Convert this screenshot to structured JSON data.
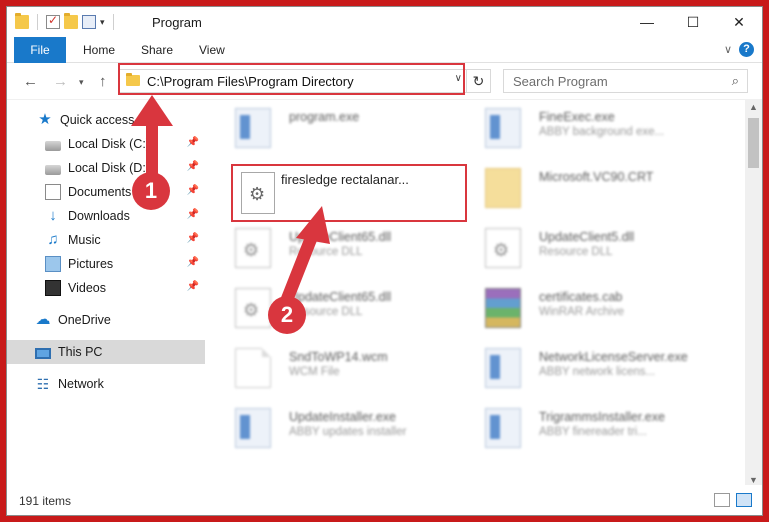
{
  "window": {
    "title": "Program",
    "controls": {
      "minimize": "—",
      "maximize": "☐",
      "close": "✕"
    }
  },
  "ribbon": {
    "tabs": [
      "File",
      "Home",
      "Share",
      "View"
    ],
    "expand_icon": "chevron-down-icon",
    "help": "?"
  },
  "nav": {
    "back": "←",
    "forward": "→",
    "recent": "▾",
    "up": "↑",
    "address": "C:\\Program Files\\Program Directory",
    "address_drop": "∨",
    "refresh": "↻",
    "search_placeholder": "Search Program",
    "search_icon": "⌕"
  },
  "sidebar": {
    "items": [
      {
        "label": "Quick access",
        "icon": "star-icon",
        "pinned": false
      },
      {
        "label": "Local Disk (C:)",
        "icon": "disk-icon",
        "pinned": true
      },
      {
        "label": "Local Disk (D:)",
        "icon": "disk-icon",
        "pinned": true
      },
      {
        "label": "Documents",
        "icon": "documents-icon",
        "pinned": true
      },
      {
        "label": "Downloads",
        "icon": "downloads-icon",
        "pinned": true
      },
      {
        "label": "Music",
        "icon": "music-icon",
        "pinned": true
      },
      {
        "label": "Pictures",
        "icon": "pictures-icon",
        "pinned": true
      },
      {
        "label": "Videos",
        "icon": "videos-icon",
        "pinned": true
      },
      {
        "label": "OneDrive",
        "icon": "onedrive-icon",
        "pinned": false
      },
      {
        "label": "This PC",
        "icon": "this-pc-icon",
        "pinned": false,
        "selected": true
      },
      {
        "label": "Network",
        "icon": "network-icon",
        "pinned": false
      }
    ]
  },
  "files": [
    {
      "name": "program.exe",
      "desc": "",
      "icon": "app-icon"
    },
    {
      "name": "FineExec.exe",
      "desc": "ABBY background exe...",
      "icon": "app-icon"
    },
    {
      "name": "firesledge rectalanar...",
      "desc": "",
      "icon": "gear-file-icon",
      "highlighted": true
    },
    {
      "name": "Microsoft.VC90.CRT",
      "desc": "",
      "icon": "folder-icon"
    },
    {
      "name": "UpdateClient65.dll",
      "desc": "Resource DLL",
      "icon": "gear-file-icon"
    },
    {
      "name": "UpdateClient5.dll",
      "desc": "Resource DLL",
      "icon": "gear-file-icon"
    },
    {
      "name": "UpdateClient65.dll",
      "desc": "Resource DLL",
      "icon": "gear-file-icon"
    },
    {
      "name": "certificates.cab",
      "desc": "WinRAR Archive",
      "icon": "archive-icon"
    },
    {
      "name": "SndToWP14.wcm",
      "desc": "WCM File",
      "icon": "document-icon"
    },
    {
      "name": "NetworkLicenseServer.exe",
      "desc": "ABBY network licens...",
      "icon": "app-icon"
    },
    {
      "name": "UpdateInstaller.exe",
      "desc": "ABBY updates installer",
      "icon": "app-icon"
    },
    {
      "name": "TrigrammsInstaller.exe",
      "desc": "ABBY finereader tri...",
      "icon": "app-icon"
    }
  ],
  "status": {
    "items_count": "191 items"
  },
  "annotations": {
    "step1": "1",
    "step2": "2"
  },
  "colors": {
    "accent": "#1979ca",
    "annotation": "#d9363e",
    "background": "#c81a1a"
  }
}
